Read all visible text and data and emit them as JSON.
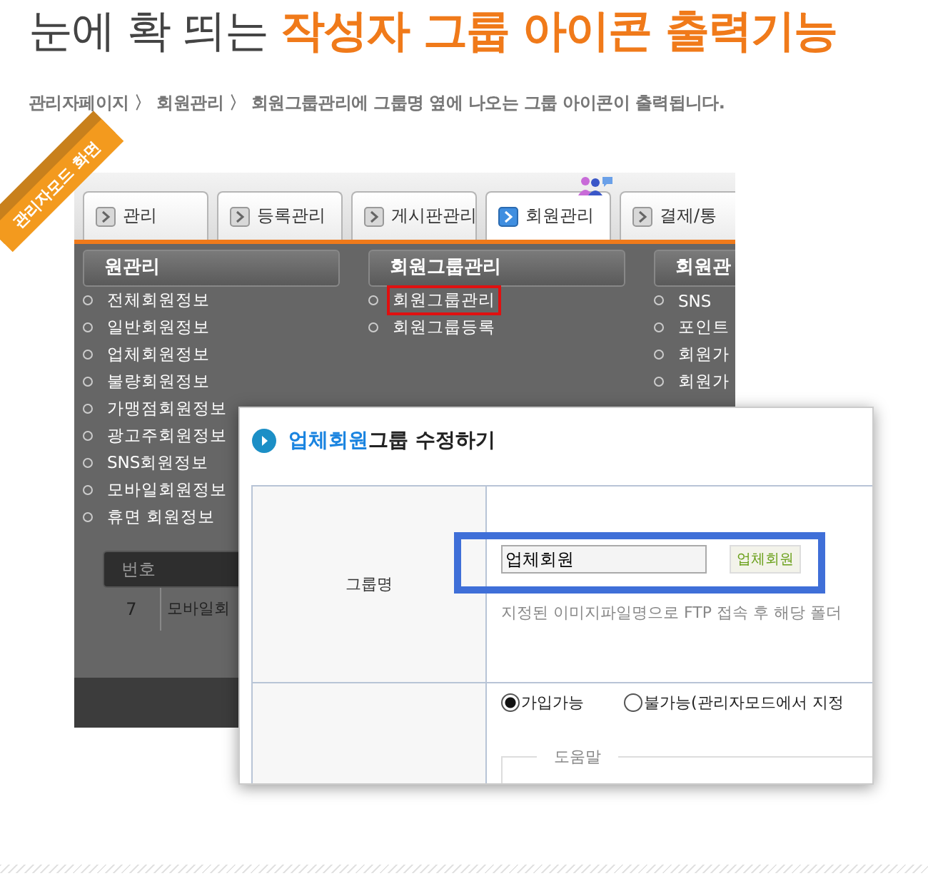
{
  "headline": {
    "plain": "눈에 확 띄는",
    "accent": "작성자 그룹 아이콘 출력기능"
  },
  "description": "관리자페이지 〉 회원관리 〉 회원그룹관리에 그룹명 옆에 나오는 그룹 아이콘이 출력됩니다.",
  "ribbon": "관리자모드 화면",
  "admin_screen": {
    "tabs": [
      {
        "label": "관리",
        "selected": false
      },
      {
        "label": "등록관리",
        "selected": false
      },
      {
        "label": "게시판관리",
        "selected": false
      },
      {
        "label": "회원관리",
        "selected": true
      },
      {
        "label": "결제/통",
        "selected": false
      }
    ],
    "menu_columns": [
      {
        "title": "원관리",
        "items": [
          {
            "label": "전체회원정보",
            "highlighted": false
          },
          {
            "label": "일반회원정보",
            "highlighted": false
          },
          {
            "label": "업체회원정보",
            "highlighted": false
          },
          {
            "label": "불량회원정보",
            "highlighted": false
          },
          {
            "label": "가맹점회원정보",
            "highlighted": false
          },
          {
            "label": "광고주회원정보",
            "highlighted": false
          },
          {
            "label": "SNS회원정보",
            "highlighted": false
          },
          {
            "label": "모바일회원정보",
            "highlighted": false
          },
          {
            "label": "휴면 회원정보",
            "highlighted": false
          }
        ]
      },
      {
        "title": "회원그룹관리",
        "items": [
          {
            "label": "회원그룹관리",
            "highlighted": true
          },
          {
            "label": "회원그룹등록",
            "highlighted": false
          }
        ]
      },
      {
        "title": "회원관",
        "items": [
          {
            "label": "SNS",
            "highlighted": false
          },
          {
            "label": "포인트",
            "highlighted": false
          },
          {
            "label": "회원가",
            "highlighted": false
          },
          {
            "label": "회원가",
            "highlighted": false
          }
        ]
      }
    ],
    "table": {
      "header": "번호",
      "rows": [
        {
          "number": "7",
          "name": "모바일회"
        }
      ]
    }
  },
  "dialog": {
    "title_accent": "업체회원",
    "title": "그룹 수정하기",
    "group_name_label": "그룹명",
    "group_name_value": "업체회원",
    "group_icon_text": "업체회원",
    "help_text": "지정된 이미지파일명으로 FTP 접속 후 해당 폴더",
    "options": [
      {
        "label": "가입가능",
        "selected": true
      },
      {
        "label": "불가능(관리자모드에서 지정",
        "selected": false
      }
    ],
    "fieldset_legend": "도움말"
  }
}
